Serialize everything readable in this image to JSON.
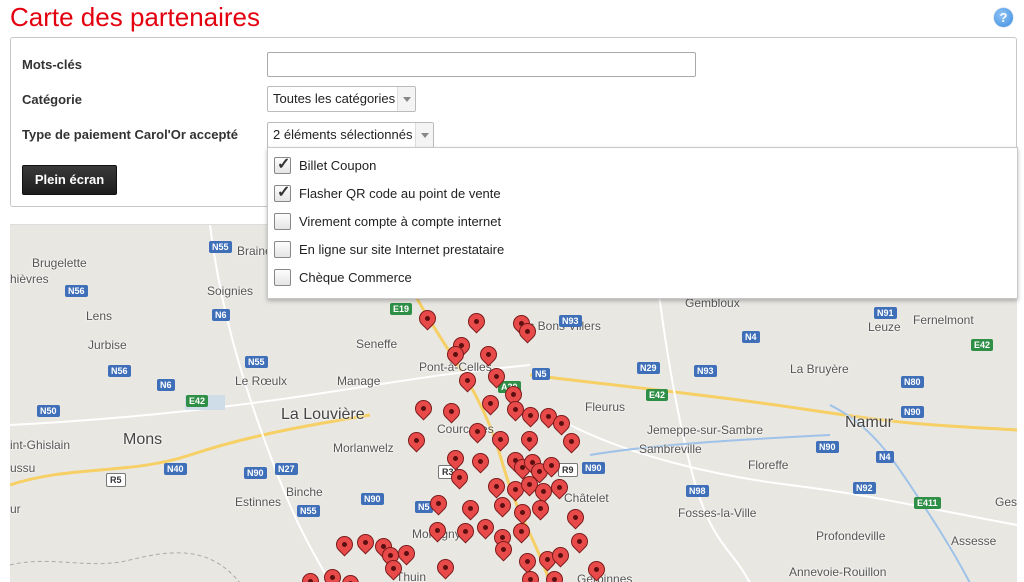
{
  "page": {
    "title": "Carte des partenaires",
    "help_icon": "?"
  },
  "filters": {
    "keywords_label": "Mots-clés",
    "keywords_value": "",
    "category_label": "Catégorie",
    "category_value": "Toutes les catégories",
    "payment_label": "Type de paiement Carol'Or accepté",
    "payment_value": "2 éléments sélectionnés",
    "fullscreen_label": "Plein écran"
  },
  "payment_options": [
    {
      "label": "Billet Coupon",
      "checked": true,
      "check_glyph": "✓"
    },
    {
      "label": "Flasher QR code au point de vente",
      "checked": true,
      "check_glyph": "✓"
    },
    {
      "label": "Virement compte à compte internet",
      "checked": false,
      "check_glyph": ""
    },
    {
      "label": "En ligne sur site Internet prestataire",
      "checked": false,
      "check_glyph": ""
    },
    {
      "label": "Chèque Commerce",
      "checked": false,
      "check_glyph": ""
    }
  ],
  "map": {
    "towns": [
      "Brugelette",
      "hièvres",
      "Soignies",
      "Lens",
      "Jurbise",
      "Le Rœulx",
      "Manage",
      "Seneffe",
      "Pont-à-Celles",
      "Les Bons Villers",
      "La Louvière",
      "Morlanwelz",
      "Mons",
      "int-Ghislain",
      "ussu",
      "Binche",
      "Estinnes",
      "ur",
      "Courcelles",
      "Fleurus",
      "Jemeppe-sur-Sambre",
      "Sambreville",
      "Floreffe",
      "Namur",
      "Châtelet",
      "Fosses-la-Ville",
      "Profondeville",
      "Gembloux",
      "Leuze",
      "Fernelmont",
      "La Bruyère",
      "Assesse",
      "Annevoie-Rouillon",
      "Ges",
      "Braine",
      "Montigny",
      "Thuin",
      "Gerpinnes"
    ],
    "roads": [
      "N55",
      "N56",
      "N6",
      "N56",
      "N55",
      "N6",
      "E42",
      "N50",
      "N40",
      "N90",
      "N27",
      "R5",
      "E19",
      "N93",
      "N4",
      "N29",
      "N93",
      "N91",
      "E42",
      "N80",
      "N90",
      "N5",
      "E42",
      "N90",
      "N98",
      "N4",
      "N92",
      "E411",
      "N90",
      "N5",
      "N55",
      "N90",
      "R3",
      "R9",
      "A20"
    ]
  }
}
